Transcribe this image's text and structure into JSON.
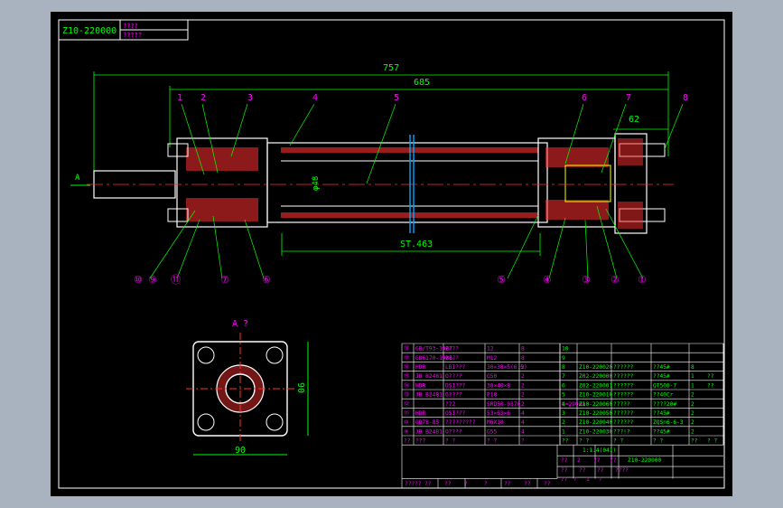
{
  "title_block": {
    "drawing_no": "Z10-220000",
    "sub1": "????",
    "sub2": "?????"
  },
  "dimensions": {
    "overall": "757",
    "body": "685",
    "end": "62",
    "stroke": "ST.463",
    "bore": "φ48"
  },
  "view_labels": {
    "section_arrow": "A",
    "end_view": "A ?",
    "width": "90",
    "height": "90"
  },
  "callouts_top": [
    "1",
    "2",
    "3",
    "4",
    "5",
    "6",
    "7",
    "8"
  ],
  "callouts_bottom_left": [
    "⑩",
    "⑨",
    "⑪",
    "⑦",
    "⑥"
  ],
  "callouts_bottom_right": [
    "⑤",
    "④",
    "③",
    "②",
    "①"
  ],
  "bom_left": [
    [
      "⑱",
      "GB/T93-1987",
      "????",
      "12",
      "8"
    ],
    [
      "⑰",
      "GB6170-1986",
      "????",
      "M12",
      "8"
    ],
    [
      "⑯",
      "HDR",
      "LBI???",
      "30×38×5(6.5)",
      "2"
    ],
    [
      "⑮",
      "JB B2481",
      "O????",
      "G50",
      "2"
    ],
    [
      "⑭",
      "HDR",
      "DSI???",
      "30×40×8",
      "2"
    ],
    [
      "⑬",
      "JB B2481",
      "O????",
      "P18",
      "2"
    ],
    [
      "⑫",
      "",
      "??2",
      "SRD50-0370",
      "2",
      "L=290mm"
    ],
    [
      "⑪",
      "HDR",
      "OSI???",
      "53×63×6",
      "4"
    ],
    [
      "⑩",
      "GB78-85",
      "?????????",
      "M6X10",
      "4"
    ],
    [
      "⑨",
      "JB B2481",
      "O????",
      "G55",
      "4"
    ],
    [
      "??",
      "???",
      "? ?",
      "? ?",
      "?"
    ]
  ],
  "bom_right": [
    [
      "10",
      "",
      "",
      "",
      ""
    ],
    [
      "9",
      "",
      "",
      "",
      ""
    ],
    [
      "8",
      "Z10-220020",
      "??????",
      "??45#",
      "8"
    ],
    [
      "7",
      "Z02-220000",
      "??????",
      "??45#",
      "1",
      "??"
    ],
    [
      "6",
      "Z02-220001",
      "??????",
      "QT500-7",
      "1",
      "??"
    ],
    [
      "5",
      "Z10-220010",
      "??????",
      "??40Cr",
      "2"
    ],
    [
      "4",
      "Z10-220060",
      "?????",
      "????20#",
      "2"
    ],
    [
      "3",
      "Z10-220050",
      "??????",
      "??45#",
      "2"
    ],
    [
      "2",
      "Z10-220040",
      "??????",
      "ZQSn6-6-3",
      "2"
    ],
    [
      "1",
      "Z10-220030",
      "???!?",
      "??45#",
      "2"
    ],
    [
      "??",
      "? ?",
      "? ?",
      "? ?",
      "??",
      "? ?"
    ]
  ],
  "footer": {
    "scale": "1:1.4(041)",
    "code": "Z10-220000",
    "r1": [
      "??",
      "2",
      "??",
      "??"
    ],
    "r2": [
      "??",
      "??",
      "??",
      "????"
    ],
    "r3": [
      "??",
      "?",
      "1",
      "?"
    ],
    "bottom": [
      "?????",
      "??",
      "??",
      "?",
      "?",
      "??",
      "??",
      "??"
    ]
  },
  "colors": {
    "outline": "#ffffff",
    "dim": "#00ff00",
    "part": "#ffff00",
    "hatch": "#ff3030",
    "label": "#ff00ff",
    "center": "#ff3030",
    "bg": "#000000"
  }
}
